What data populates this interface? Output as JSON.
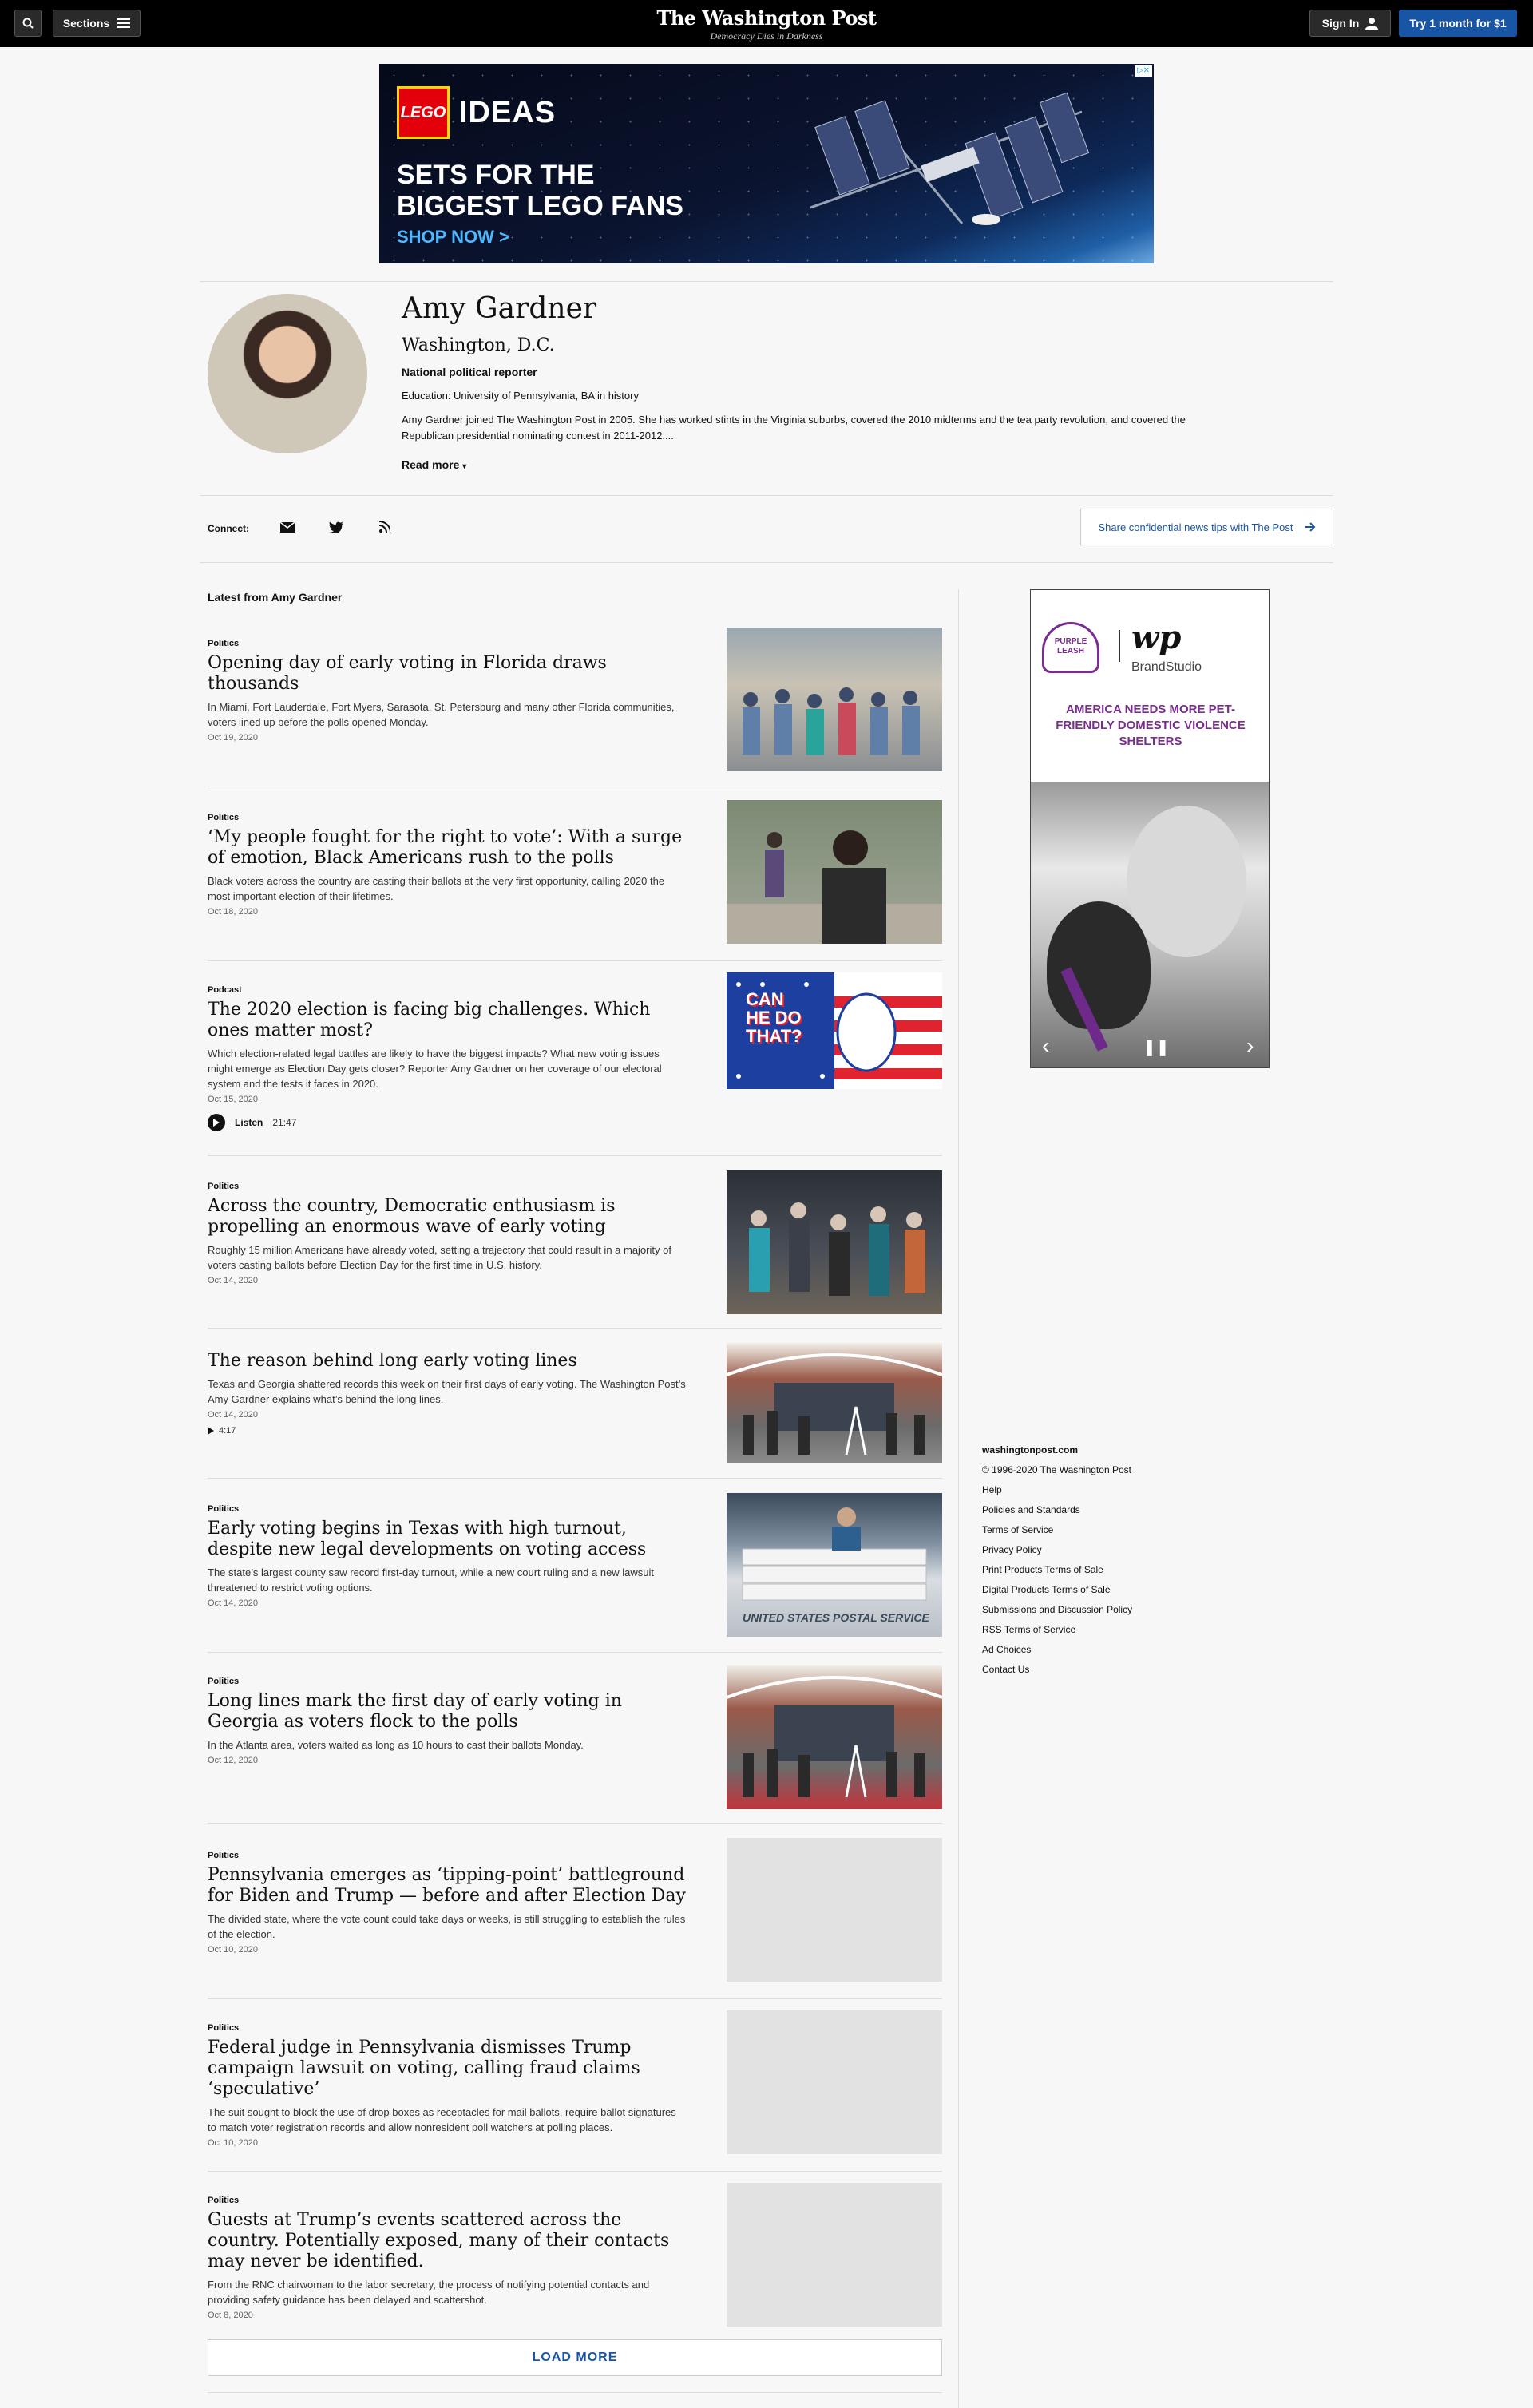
{
  "header": {
    "sections_label": "Sections",
    "logo": "The Washington Post",
    "tagline": "Democracy Dies in Darkness",
    "signin_label": "Sign In",
    "trial_label": "Try 1 month for $1"
  },
  "ad_banner": {
    "brand": "LEGO",
    "product": "IDEAS",
    "headline_line1": "SETS FOR THE",
    "headline_line2": "BIGGEST LEGO FANS",
    "cta": "SHOP NOW >"
  },
  "author": {
    "name": "Amy Gardner",
    "location": "Washington, D.C.",
    "role": "National political reporter",
    "education": "Education: University of Pennsylvania, BA in history",
    "bio": "Amy Gardner joined The Washington Post in 2005. She has worked stints in the Virginia suburbs, covered the 2010 midterms and the tea party revolution, and covered the Republican presidential nominating contest in 2011-2012....",
    "read_more": "Read more"
  },
  "connect": {
    "label": "Connect:",
    "icons": [
      "email-icon",
      "twitter-icon",
      "rss-icon"
    ],
    "tips_label": "Share confidential news tips with The Post"
  },
  "latest_label": "Latest from Amy Gardner",
  "stories": [
    {
      "kicker": "Politics",
      "headline": "Opening day of early voting in Florida draws thousands",
      "blurb": "In Miami, Fort Lauderdale, Fort Myers, Sarasota, St. Petersburg and many other Florida communities, voters lined up before the polls opened Monday.",
      "date": "Oct 19, 2020"
    },
    {
      "kicker": "Politics",
      "headline": "‘My people fought for the right to vote’: With a surge of emotion, Black Americans rush to the polls",
      "blurb": "Black voters across the country are casting their ballots at the very first opportunity, calling 2020 the most important election of their lifetimes.",
      "date": "Oct 18, 2020"
    },
    {
      "kicker": "Podcast",
      "headline": "The 2020 election is facing big challenges. Which ones matter most?",
      "blurb": "Which election-related legal battles are likely to have the biggest impacts? What new voting issues might emerge as Election Day gets closer? Reporter Amy Gardner on her coverage of our electoral system and the tests it faces in 2020.",
      "date": "Oct 15, 2020",
      "audio_label": "Listen",
      "audio_duration": "21:47",
      "thumb_text": "CAN HE DO THAT?"
    },
    {
      "kicker": "Politics",
      "headline": "Across the country, Democratic enthusiasm is propelling an enormous wave of early voting",
      "blurb": "Roughly 15 million Americans have already voted, setting a trajectory that could result in a majority of voters casting ballots before Election Day for the first time in U.S. history.",
      "date": "Oct 14, 2020"
    },
    {
      "kicker": "",
      "headline": "The reason behind long early voting lines",
      "blurb": "Texas and Georgia shattered records this week on their first days of early voting. The Washington Post’s Amy Gardner explains what’s behind the long lines.",
      "date": "Oct 14, 2020",
      "video_duration": "4:17"
    },
    {
      "kicker": "Politics",
      "headline": "Early voting begins in Texas with high turnout, despite new legal developments on voting access",
      "blurb": "The state’s largest county saw record first-day turnout, while a new court ruling and a new lawsuit threatened to restrict voting options.",
      "date": "Oct 14, 2020",
      "thumb_text": "UNITED STATES POSTAL SERVICE"
    },
    {
      "kicker": "Politics",
      "headline": "Long lines mark the first day of early voting in Georgia as voters flock to the polls",
      "blurb": "In the Atlanta area, voters waited as long as 10 hours to cast their ballots Monday.",
      "date": "Oct 12, 2020"
    },
    {
      "kicker": "Politics",
      "headline": "Pennsylvania emerges as ‘tipping-point’ battleground for Biden and Trump — before and after Election Day",
      "blurb": "The divided state, where the vote count could take days or weeks, is still struggling to establish the rules of the election.",
      "date": "Oct 10, 2020"
    },
    {
      "kicker": "Politics",
      "headline": "Federal judge in Pennsylvania dismisses Trump campaign lawsuit on voting, calling fraud claims ‘speculative’",
      "blurb": "The suit sought to block the use of drop boxes as receptacles for mail ballots, require ballot signatures to match voter registration records and allow nonresident poll watchers at polling places.",
      "date": "Oct 10, 2020"
    },
    {
      "kicker": "Politics",
      "headline": "Guests at Trump’s events scattered across the country. Potentially exposed, many of their contacts may never be identified.",
      "blurb": "From the RNC chairwoman to the labor secretary, the process of notifying potential contacts and providing safety guidance has been delayed and scattershot.",
      "date": "Oct 8, 2020"
    }
  ],
  "load_more": "LOAD MORE",
  "rail_ad": {
    "brand_badge": "PURPLE LEASH",
    "publisher_mark": "wp",
    "publisher_label": "BrandStudio",
    "headline": "AMERICA NEEDS MORE PET-FRIENDLY DOMESTIC VIOLENCE SHELTERS",
    "accent": "#7a2d8f"
  },
  "footer": {
    "site": "washingtonpost.com",
    "copyright": "© 1996-2020 The Washington Post",
    "links": [
      "Help",
      "Policies and Standards",
      "Terms of Service",
      "Privacy Policy",
      "Print Products Terms of Sale",
      "Digital Products Terms of Sale",
      "Submissions and Discussion Policy",
      "RSS Terms of Service",
      "Ad Choices",
      "Contact Us"
    ]
  },
  "colors": {
    "brand_blue": "#1955a5",
    "masthead_bg": "#000000",
    "page_bg": "#f7f7f7"
  }
}
